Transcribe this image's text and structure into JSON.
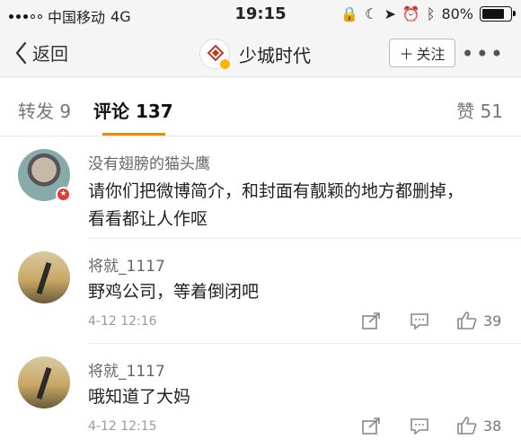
{
  "status_bar": {
    "carrier": "中国移动",
    "network": "4G",
    "time": "19:15",
    "battery": "80%",
    "battery_level": 0.8
  },
  "nav": {
    "back_label": "返回",
    "title": "少城时代",
    "follow_label": "关注",
    "more_icon": "more-icon"
  },
  "tabs": [
    {
      "label": "转发 9"
    },
    {
      "label": "评论 137"
    },
    {
      "label": "赞 51"
    }
  ],
  "comments": [
    {
      "name": "没有翅膀的猫头鹰",
      "lines": [
        "请你们把微博简介，和封面有靓颖的地方都删掉，",
        "看看都让人作呕"
      ]
    },
    {
      "name": "将就_1117",
      "text": "野鸡公司，等着倒闭吧",
      "time": "4-12 12:16",
      "likes": "39"
    },
    {
      "name": "将就_1117",
      "text": "哦知道了大妈",
      "time": "4-12 12:15",
      "likes": "38"
    }
  ],
  "colors": {
    "accent": "#f08a00",
    "badge": "#e53935"
  }
}
